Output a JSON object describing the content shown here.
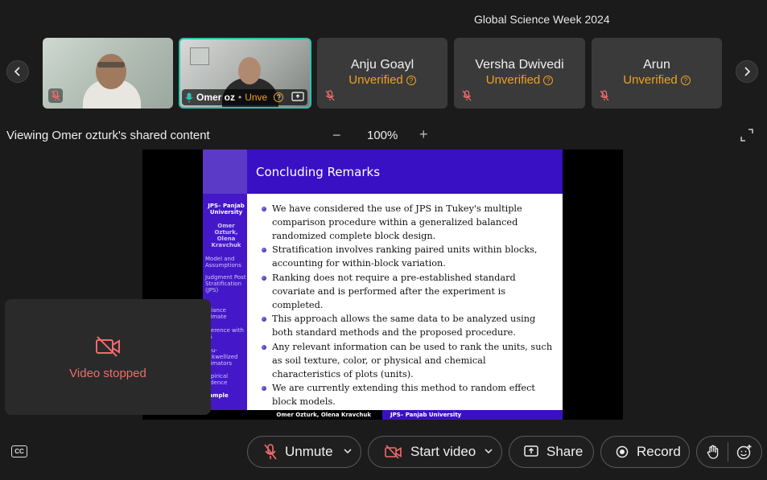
{
  "meeting": {
    "title": "Global Science Week 2024"
  },
  "participants": [
    {
      "name": "",
      "status": "",
      "muted": true,
      "video": true
    },
    {
      "name": "Omer oz",
      "status": "Unve",
      "muted": false,
      "video": true
    },
    {
      "name": "Anju Goayl",
      "status": "Unverified",
      "muted": true,
      "video": false
    },
    {
      "name": "Versha Dwivedi",
      "status": "Unverified",
      "muted": true,
      "video": false
    },
    {
      "name": "Arun",
      "status": "Unverified",
      "muted": true,
      "video": false
    }
  ],
  "share": {
    "label": "Viewing Omer ozturk's shared content",
    "zoom": "100%",
    "zoom_out": "−",
    "zoom_in": "+"
  },
  "slide": {
    "title": "Concluding Remarks",
    "sidebar": [
      "JPS– Panjab University",
      "Omer Ozturk, Olena Kravchuk",
      "Model and Assumptions",
      "Judgment Post Stratification (JPS)",
      "ariance stimate",
      "nference with PS",
      "seu-ackwellized stimators",
      "mpirical vidence",
      "xample"
    ],
    "bullets": [
      "We have considered the use of JPS in Tukey's multiple comparison procedure within a generalized balanced randomized complete block design.",
      "Stratification involves ranking paired units within blocks, accounting for within-block variation.",
      "Ranking does not require a pre-established standard covariate and is performed after the experiment is completed.",
      "This approach allows the same data to be analyzed using both standard methods and the proposed procedure.",
      "Any relevant information can be used to rank the units, such as soil texture, color, or physical and chemical characteristics of plots (units).",
      "We are currently extending this method to random effect block models."
    ],
    "footer_left": "Omer Ozturk, Olena Kravchuk",
    "footer_right": "JPS– Panjab University"
  },
  "self_view": {
    "status": "Video stopped"
  },
  "controls": {
    "unmute": "Unmute",
    "start_video": "Start video",
    "share": "Share",
    "record": "Record",
    "cc": "CC"
  },
  "colors": {
    "warning": "#f0a020",
    "danger": "#f26b6b",
    "active_speaker": "#2cc2b2",
    "slide_purple": "#3a10c4"
  }
}
